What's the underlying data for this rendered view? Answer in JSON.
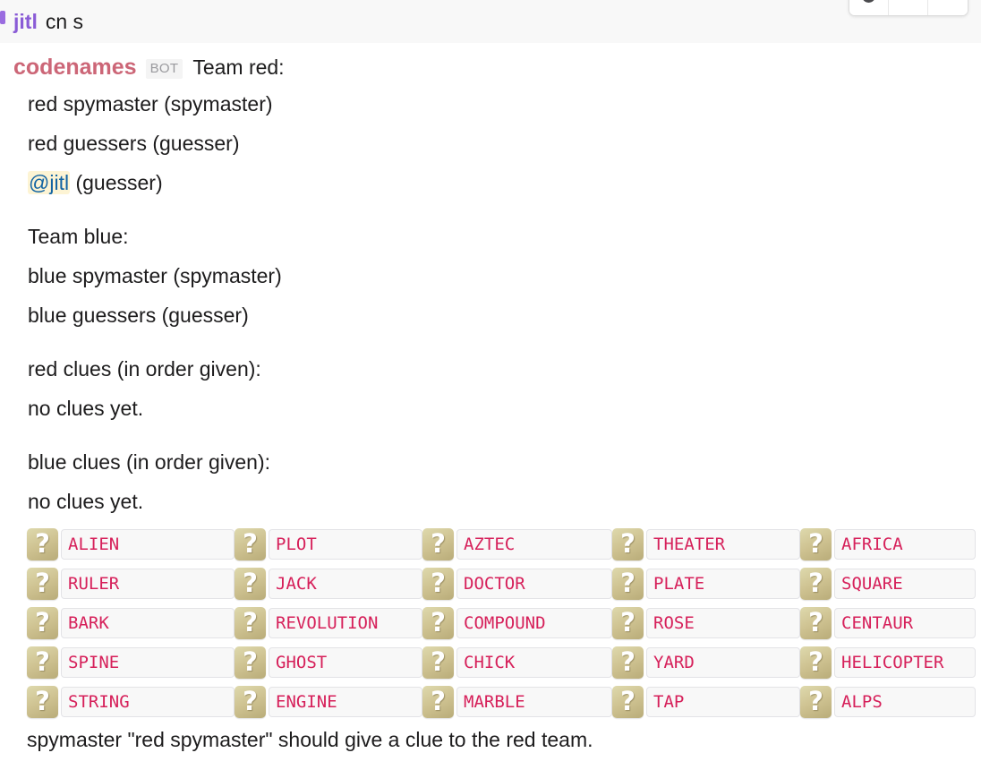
{
  "colors": {
    "user_name": "#8a5cd6",
    "bot_name": "#cc6677",
    "mention_text": "#1264a3",
    "mention_bg": "#fdf4d4",
    "code_text": "#d6205a",
    "code_bg": "#f8f8f8",
    "emoji_tan": "#cfc392",
    "hover_row_bg": "#f8f8f8",
    "body_text": "#1d1c1d"
  },
  "hover_toolbar": {
    "buttons": [
      {
        "name": "emoji-reaction-button",
        "icon": "emoji-face-icon"
      },
      {
        "name": "more-actions-button",
        "icon": "kebab-menu-icon"
      },
      {
        "name": "overflow-button",
        "icon": "blank-icon"
      }
    ]
  },
  "user_message": {
    "author": "jitl",
    "text": "cn s"
  },
  "bot_message": {
    "author": "codenames",
    "badge": "BOT",
    "first_line": "Team red:",
    "paragraphs": [
      {
        "lines": [
          {
            "text": "red spymaster (spymaster)"
          },
          {
            "text": "red guessers (guesser)"
          },
          {
            "mention": "@jitl",
            "text": " (guesser)"
          }
        ]
      },
      {
        "lines": [
          {
            "text": "Team blue:"
          },
          {
            "text": "blue spymaster (spymaster)"
          },
          {
            "text": "blue guessers (guesser)"
          }
        ]
      },
      {
        "lines": [
          {
            "text": "red clues (in order given):"
          },
          {
            "text": "no clues yet."
          }
        ]
      },
      {
        "lines": [
          {
            "text": "blue clues (in order given):"
          },
          {
            "text": "no clues yet."
          }
        ]
      }
    ],
    "closing_line": "spymaster \"red spymaster\" should give a clue to the red team."
  },
  "board": {
    "card_icon": "question-mark-emoji",
    "rows": [
      [
        "ALIEN",
        "PLOT",
        "AZTEC",
        "THEATER",
        "AFRICA"
      ],
      [
        "RULER",
        "JACK",
        "DOCTOR",
        "PLATE",
        "SQUARE"
      ],
      [
        "BARK",
        "REVOLUTION",
        "COMPOUND",
        "ROSE",
        "CENTAUR"
      ],
      [
        "SPINE",
        "GHOST",
        "CHICK",
        "YARD",
        "HELICOPTER"
      ],
      [
        "STRING",
        "ENGINE",
        "MARBLE",
        "TAP",
        "ALPS"
      ]
    ]
  }
}
